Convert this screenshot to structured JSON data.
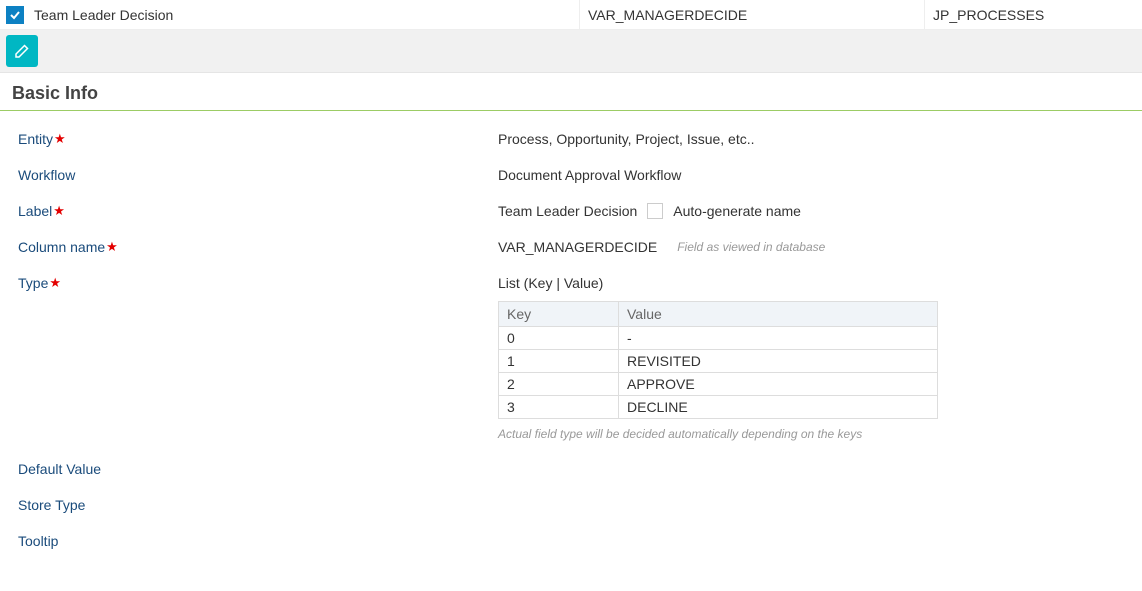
{
  "topRow": {
    "title": "Team Leader Decision",
    "col2": "VAR_MANAGERDECIDE",
    "col3": "JP_PROCESSES"
  },
  "sectionTitle": "Basic Info",
  "labels": {
    "entity": "Entity",
    "workflow": "Workflow",
    "label": "Label",
    "columnName": "Column name",
    "type": "Type",
    "defaultValue": "Default Value",
    "storeType": "Store Type",
    "tooltip": "Tooltip"
  },
  "values": {
    "entity": "Process, Opportunity, Project, Issue, etc..",
    "workflow": "Document Approval Workflow",
    "label": "Team Leader Decision",
    "autoGenerate": "Auto-generate name",
    "columnName": "VAR_MANAGERDECIDE",
    "columnNameHint": "Field as viewed in database",
    "type": "List (Key | Value)",
    "typeHint": "Actual field type will be decided automatically depending on the keys"
  },
  "table": {
    "headers": {
      "key": "Key",
      "value": "Value"
    },
    "rows": [
      {
        "key": "0",
        "value": "-"
      },
      {
        "key": "1",
        "value": "REVISITED"
      },
      {
        "key": "2",
        "value": "APPROVE"
      },
      {
        "key": "3",
        "value": "DECLINE"
      }
    ]
  }
}
